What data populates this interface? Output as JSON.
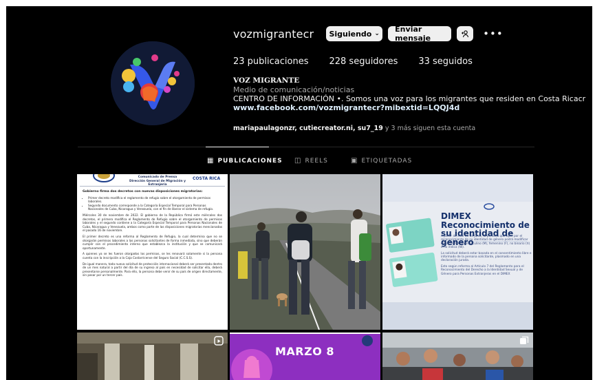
{
  "profile": {
    "username": "vozmigrantecr",
    "following_button": "Siguiendo",
    "message_button": "Enviar mensaje",
    "stats": {
      "posts": "23 publicaciones",
      "followers": "228 seguidores",
      "following": "33 seguidos"
    },
    "bio": {
      "name": "VOZ MIGRANTE",
      "category": "Medio de comunicación/noticias",
      "text": "CENTRO DE INFORMACIÓN •. Somos una voz para los migrantes que residen en Costa Ricacr",
      "link": "www.facebook.com/vozmigrantecr?mibextid=LQQJ4d"
    },
    "followed_by": {
      "names": "mariapaulagonzr, cutiecreator.ni, su7_19",
      "suffix": " y 3 más siguen esta cuenta"
    }
  },
  "tabs": [
    {
      "label": "PUBLICACIONES",
      "icon": "grid-icon",
      "active": true
    },
    {
      "label": "REELS",
      "icon": "reels-icon",
      "active": false
    },
    {
      "label": "ETIQUETADAS",
      "icon": "tagged-icon",
      "active": false
    }
  ],
  "posts": {
    "doc": {
      "header_line1": "Comunicado de Prensa",
      "header_line2": "Dirección General de Migración y Extranjería",
      "country": "COSTA RICA",
      "subtitle": "Gobierno firma dos decretos con nuevas disposiciones migratorias:",
      "bullet1": "Primer decreto modifica el reglamento de refugio sobre el otorgamiento de permisos laborales.",
      "bullet2": "Segundo documento corresponde a la Categoría Especial Temporal para Personas Nacionales de Cuba, Nicaragua y Venezuela, con el fin de liberar el sistema de refugio.",
      "para1": "Miércoles 30 de noviembre de 2022. El gobierno de la República firmó este miércoles dos decretos, el primero modifica el Reglamento de Refugio sobre el otorgamiento de permisos laborales y el segundo contiene a la Categoría Especial Temporal para Personas Nacionales de Cuba, Nicaragua y Venezuela, ambos como parte de las disposiciones migratorias mencionadas el pasado 16 de noviembre.",
      "para2": "El primer decreto es una reforma al Reglamento de Refugio, la cual determina que no se otorgarán permisos laborales a las personas solicitantes de forma inmediata, sino que deberán cumplir con el procedimiento interno que establezca la institución y que se comunicará oportunamente.",
      "para3": "A quienes ya se les fueron otorgados los permisos, se les renovará solamente si la persona cuenta con la inscripción a la Caja Costarricense del Seguro Social (C.C.S.S).",
      "para4": "De igual manera, toda nueva solicitud de protección internacional deberá ser presentada dentro de un mes natural a partir del día de su ingreso al país en necesidad de solicitar ella, deberá presentarse personalmente. Para ello, la persona debe venir de su país de origen directamente, sin pasar por un tercer país."
    },
    "dimex": {
      "title": "DIMEX Reconocimiento de su identidad de genero",
      "p1": "A partir de este 16 de junio, la persona que opte por el reconocimiento de su identidad de género podrá modificar en su DIMEX por masculino (M), femenino (F), no binario (X) o no indica (NI).",
      "p2": "La solicitud deberá estar basada en el consentimiento libre e informado de la persona solicitante, plasmado en una declaración jurada.",
      "p3": "Esto según reforma al Artículo 7 del Reglamento para el Reconocimiento del Derecho a la Identidad Sexual y de Género para Personas Extranjeras en el DIMEX"
    },
    "marzo": {
      "title": "MARZO 8"
    }
  },
  "colors": {
    "background": "#000000",
    "button_bg": "#efefef",
    "link": "#e0f1ff",
    "secondary_text": "#a8a8a8",
    "avatar_bg": "#111a35",
    "marzo_bg": "#8d2fc0"
  }
}
